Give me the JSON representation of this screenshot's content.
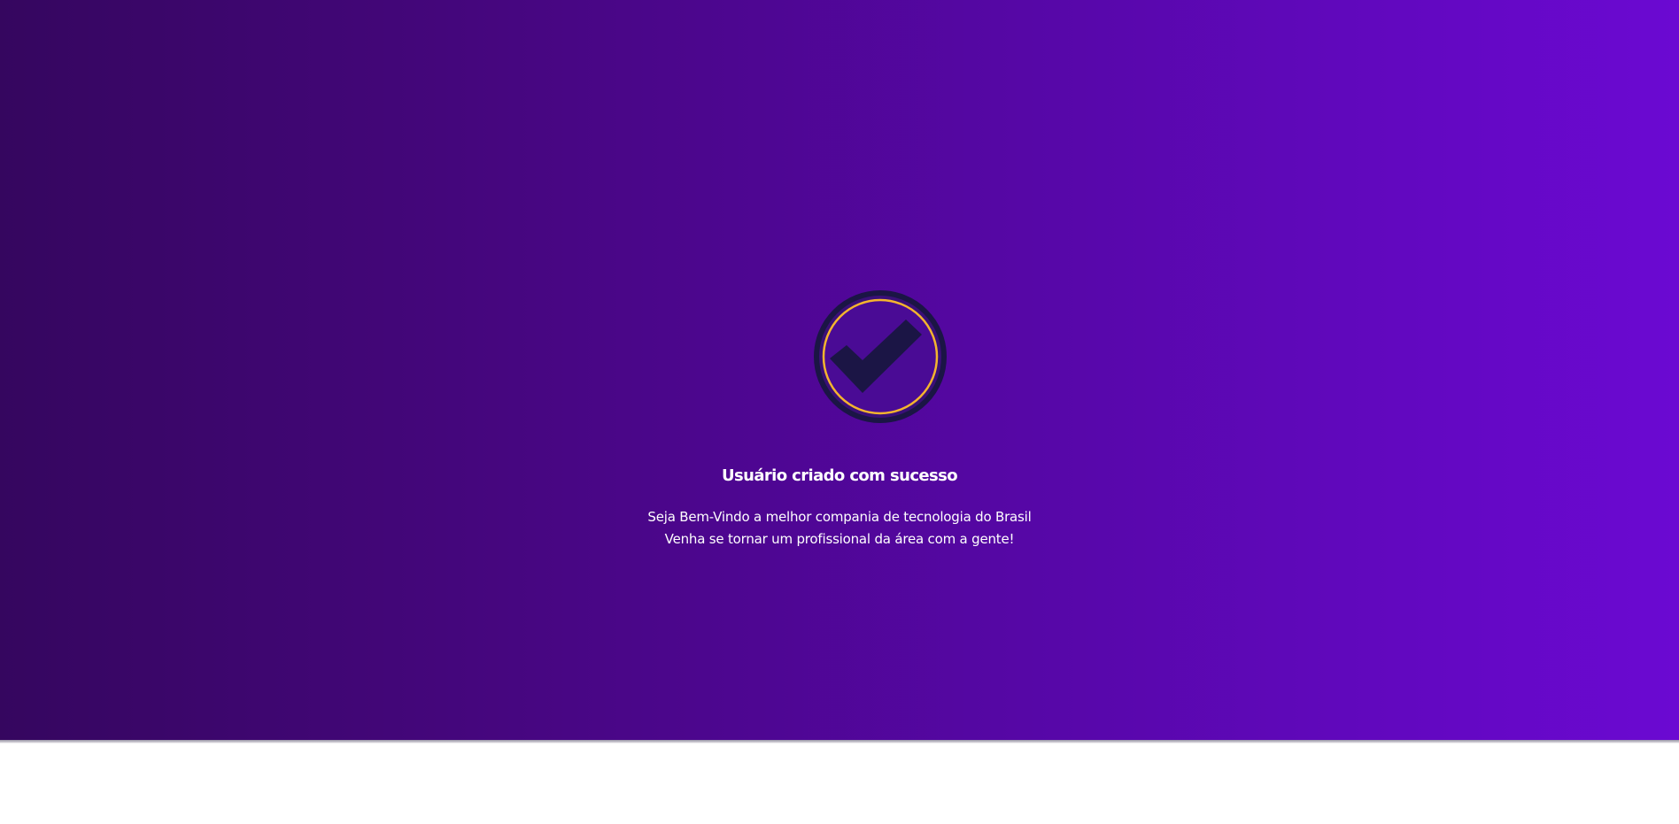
{
  "success": {
    "icon": "check-circle-icon",
    "title": "Usuário criado com sucesso",
    "message_line1": "Seja Bem-Vindo a melhor compania de tecnologia do Brasil",
    "message_line2": "Venha se tornar um profissional da área com a gente!"
  },
  "colors": {
    "gradient_start": "#35065f",
    "gradient_end": "#6b09d2",
    "icon_dark": "#1b1545",
    "icon_ring": "#f5b52e",
    "text": "#ffffff",
    "page_bg": "#ffffff"
  }
}
